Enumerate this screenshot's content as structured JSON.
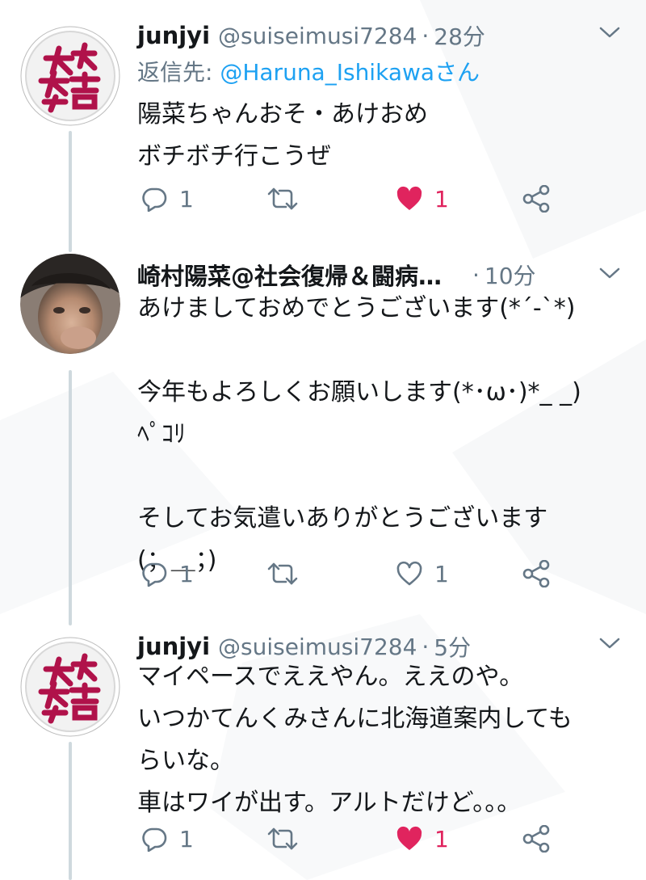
{
  "colors": {
    "text": "#14171a",
    "secondary": "#657786",
    "link": "#1da1f2",
    "like": "#e0245e",
    "thread_line": "#cfd9de",
    "seal_red": "#b0124a"
  },
  "tweets": [
    {
      "avatar_icon": "red-seal-logo-icon",
      "name": "junjyi",
      "handle": "@suiseimusi7284",
      "separator": "·",
      "time": "28分",
      "reply_prefix": "返信先: ",
      "reply_to": "@Haruna_Ishikawaさん",
      "body": [
        "陽菜ちゃんおそ・あけおめ",
        "ボチボチ行こうぜ"
      ],
      "replies": "1",
      "likes": "1",
      "liked": true
    },
    {
      "avatar_icon": "user-photo-avatar",
      "name": "崎村陽菜@社会復帰＆闘病…",
      "separator": "·",
      "time": "10分",
      "body": [
        "あけましておめでとうございます(*´-`*)",
        "",
        "今年もよろしくお願いします(*･ω･)*_ _)",
        "ﾍﾟｺﾘ",
        "",
        "そしてお気遣いありがとうございます",
        "(；＿；)"
      ],
      "replies": "1",
      "likes": "1",
      "liked": false
    },
    {
      "avatar_icon": "red-seal-logo-icon",
      "name": "junjyi",
      "handle": "@suiseimusi7284",
      "separator": "·",
      "time": "5分",
      "body": [
        "マイペースでええやん。ええのや。",
        "いつかてんくみさんに北海道案内しても",
        "らいな。",
        "車はワイが出す。アルトだけど。。。"
      ],
      "replies": "1",
      "likes": "1",
      "liked": true
    }
  ]
}
